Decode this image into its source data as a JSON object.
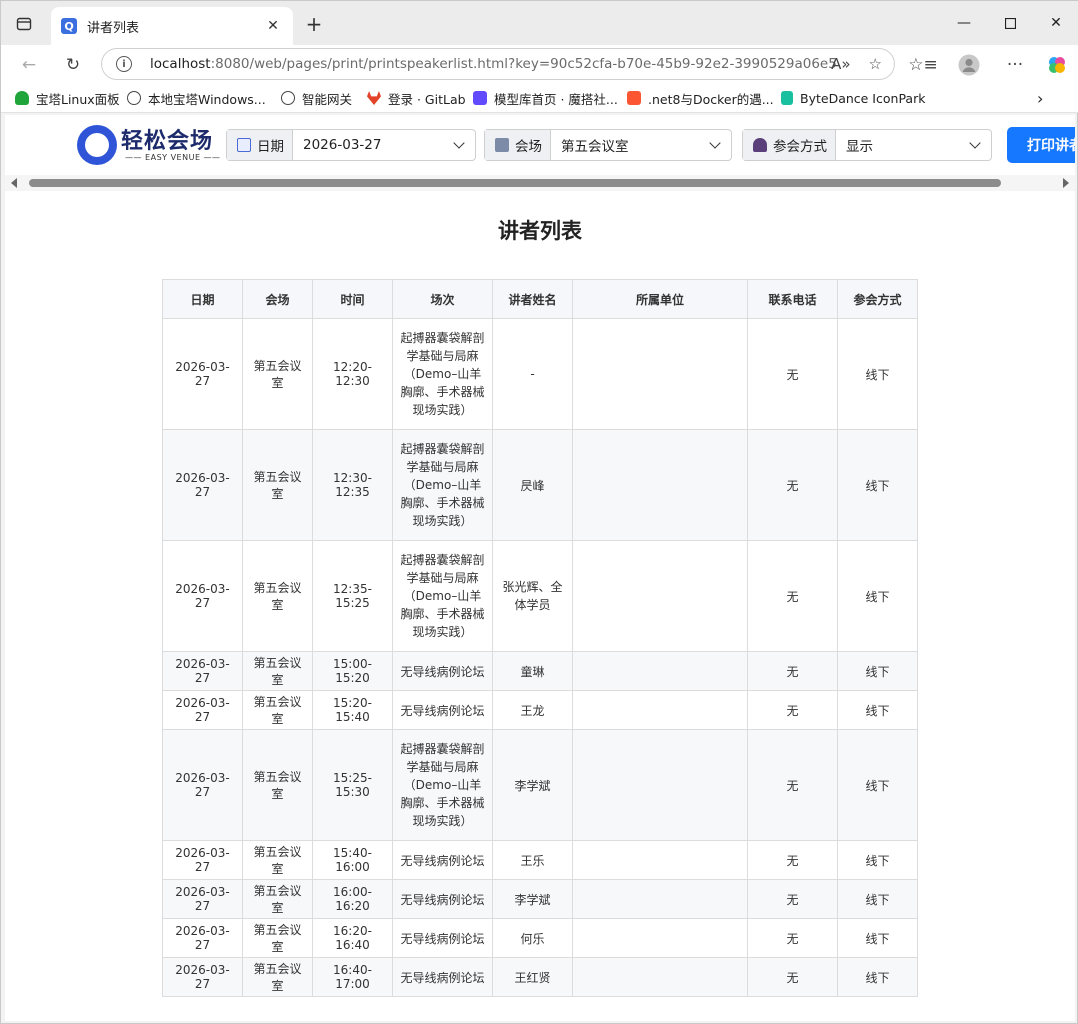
{
  "browser": {
    "tab_title": "讲者列表",
    "favicon_letter": "Q",
    "url_host": "localhost",
    "url_rest": ":8080/web/pages/print/printspeakerlist.html?key=90c52cfa-b70e-45b9-92e2-3990529a06e5",
    "bookmarks": [
      {
        "label": "宝塔Linux面板",
        "color": "#20a53a"
      },
      {
        "label": "本地宝塔Windows...",
        "color": "#444444"
      },
      {
        "label": "智能网关",
        "color": "#444444"
      },
      {
        "label": "登录 · GitLab",
        "color": "#e24329"
      },
      {
        "label": "模型库首页 · 魔搭社...",
        "color": "#624aff"
      },
      {
        "label": ".net8与Docker的遇...",
        "color": "#fc5531"
      },
      {
        "label": "ByteDance IconPark",
        "color": "#18c0a0"
      }
    ]
  },
  "toolbar": {
    "logo_title": "轻松会场",
    "logo_sub": "—— EASY VENUE ——",
    "date_label": "日期",
    "date_value": "2026-03-27",
    "venue_label": "会场",
    "venue_value": "第五会议室",
    "mode_label": "参会方式",
    "mode_value": "显示",
    "print_label": "打印讲者"
  },
  "page": {
    "title": "讲者列表"
  },
  "table": {
    "headers": [
      "日期",
      "会场",
      "时间",
      "场次",
      "讲者姓名",
      "所属单位",
      "联系电话",
      "参会方式"
    ],
    "rows": [
      {
        "date": "2026-03-27",
        "venue": "第五会议室",
        "time": "12:20-12:30",
        "session": "起搏器囊袋解剖学基础与局麻（Demo–山羊胸廓、手术器械现场实践）",
        "speaker": "-",
        "unit": "",
        "phone": "无",
        "mode": "线下"
      },
      {
        "date": "2026-03-27",
        "venue": "第五会议室",
        "time": "12:30-12:35",
        "session": "起搏器囊袋解剖学基础与局麻（Demo–山羊胸廓、手术器械现场实践）",
        "speaker": "昃峰",
        "unit": "",
        "phone": "无",
        "mode": "线下"
      },
      {
        "date": "2026-03-27",
        "venue": "第五会议室",
        "time": "12:35-15:25",
        "session": "起搏器囊袋解剖学基础与局麻（Demo–山羊胸廓、手术器械现场实践）",
        "speaker": "张光辉、全体学员",
        "unit": "",
        "phone": "无",
        "mode": "线下"
      },
      {
        "date": "2026-03-27",
        "venue": "第五会议室",
        "time": "15:00-15:20",
        "session": "无导线病例论坛",
        "speaker": "童琳",
        "unit": "",
        "phone": "无",
        "mode": "线下"
      },
      {
        "date": "2026-03-27",
        "venue": "第五会议室",
        "time": "15:20-15:40",
        "session": "无导线病例论坛",
        "speaker": "王龙",
        "unit": "",
        "phone": "无",
        "mode": "线下"
      },
      {
        "date": "2026-03-27",
        "venue": "第五会议室",
        "time": "15:25-15:30",
        "session": "起搏器囊袋解剖学基础与局麻（Demo–山羊胸廓、手术器械现场实践）",
        "speaker": "李学斌",
        "unit": "",
        "phone": "无",
        "mode": "线下"
      },
      {
        "date": "2026-03-27",
        "venue": "第五会议室",
        "time": "15:40-16:00",
        "session": "无导线病例论坛",
        "speaker": "王乐",
        "unit": "",
        "phone": "无",
        "mode": "线下"
      },
      {
        "date": "2026-03-27",
        "venue": "第五会议室",
        "time": "16:00-16:20",
        "session": "无导线病例论坛",
        "speaker": "李学斌",
        "unit": "",
        "phone": "无",
        "mode": "线下"
      },
      {
        "date": "2026-03-27",
        "venue": "第五会议室",
        "time": "16:20-16:40",
        "session": "无导线病例论坛",
        "speaker": "何乐",
        "unit": "",
        "phone": "无",
        "mode": "线下"
      },
      {
        "date": "2026-03-27",
        "venue": "第五会议室",
        "time": "16:40-17:00",
        "session": "无导线病例论坛",
        "speaker": "王红贤",
        "unit": "",
        "phone": "无",
        "mode": "线下"
      }
    ]
  },
  "icons": {
    "calendar": "calendar-icon",
    "venue": "building-icon",
    "mode": "person-icon"
  },
  "colors": {
    "accent": "#1677ff",
    "logo": "#2f54d8"
  }
}
